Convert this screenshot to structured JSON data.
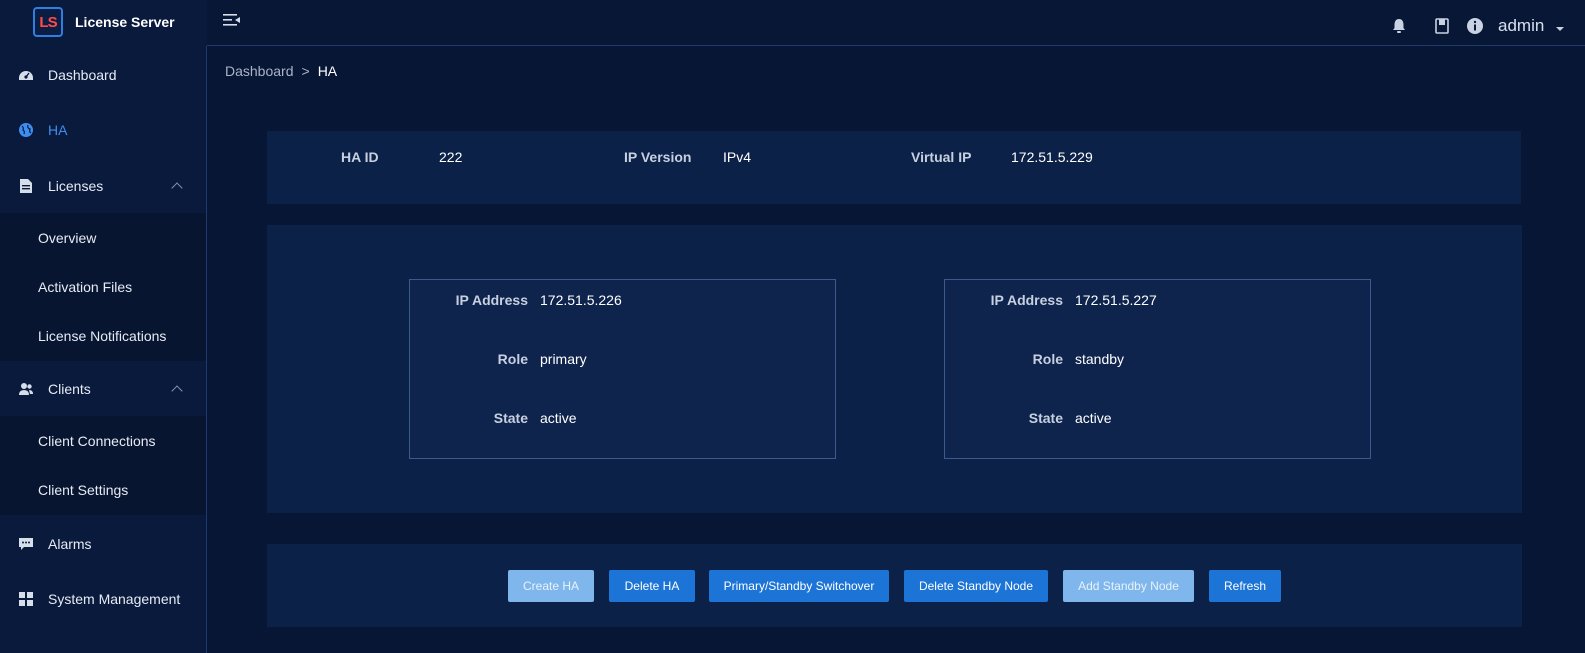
{
  "app": {
    "logo_text": "LS",
    "title": "License Server"
  },
  "header": {
    "icons": [
      "collapse-menu-icon",
      "bell-icon",
      "book-icon",
      "info-icon"
    ],
    "user": "admin"
  },
  "sidebar": {
    "items": [
      {
        "label": "Dashboard",
        "icon": "dashboard-icon"
      },
      {
        "label": "HA",
        "icon": "globe-icon",
        "active": true
      },
      {
        "label": "Licenses",
        "icon": "document-icon",
        "expanded": true,
        "children": [
          "Overview",
          "Activation Files",
          "License Notifications"
        ]
      },
      {
        "label": "Clients",
        "icon": "users-icon",
        "expanded": true,
        "children": [
          "Client Connections",
          "Client Settings"
        ]
      },
      {
        "label": "Alarms",
        "icon": "chat-icon"
      },
      {
        "label": "System Management",
        "icon": "grid-icon"
      }
    ]
  },
  "breadcrumb": {
    "parent": "Dashboard",
    "separator": ">",
    "current": "HA"
  },
  "ha_info": {
    "ha_id_label": "HA ID",
    "ha_id": "222",
    "ip_version_label": "IP Version",
    "ip_version": "IPv4",
    "virtual_ip_label": "Virtual IP",
    "virtual_ip": "172.51.5.229"
  },
  "nodes": [
    {
      "ip_label": "IP Address",
      "ip": "172.51.5.226",
      "role_label": "Role",
      "role": "primary",
      "state_label": "State",
      "state": "active"
    },
    {
      "ip_label": "IP Address",
      "ip": "172.51.5.227",
      "role_label": "Role",
      "role": "standby",
      "state_label": "State",
      "state": "active"
    }
  ],
  "actions": {
    "create_ha": "Create HA",
    "delete_ha": "Delete HA",
    "switchover": "Primary/Standby Switchover",
    "delete_standby": "Delete Standby Node",
    "add_standby": "Add Standby Node",
    "refresh": "Refresh"
  },
  "colors": {
    "background": "#071634",
    "sidebar": "#0a1a3c",
    "panel": "#0c2148",
    "accent": "#1c74d6",
    "active_text": "#3d8ef0",
    "disabled_button": "#7fb6ec"
  }
}
